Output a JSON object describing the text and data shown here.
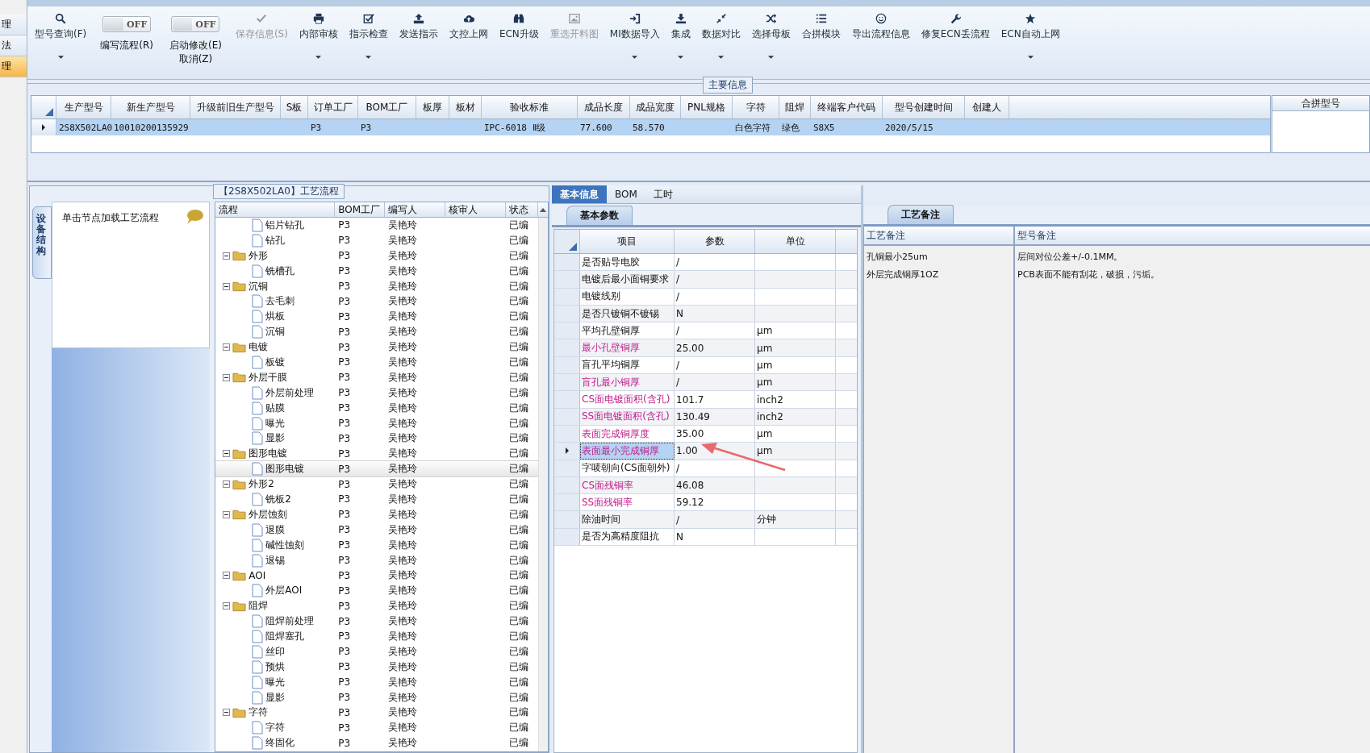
{
  "nav": {
    "items": [
      {
        "label": "理",
        "selected": false
      },
      {
        "label": "法",
        "selected": false
      },
      {
        "label": "理",
        "selected": true
      }
    ]
  },
  "toolbar": {
    "items": [
      {
        "kind": "button",
        "lines": [
          "型号查询(F)"
        ],
        "disabled": false,
        "dropdown": true
      },
      {
        "kind": "toggle",
        "state_text": "OFF",
        "on": false,
        "lines": [
          "编写流程(R)"
        ]
      },
      {
        "kind": "toggle",
        "state_text": "OFF",
        "on": false,
        "lines": [
          "启动修改(E)",
          "取消(Z)"
        ]
      },
      {
        "kind": "button",
        "lines": [
          "保存信息(S)"
        ],
        "disabled": true,
        "dropdown": false
      },
      {
        "kind": "button",
        "lines": [
          "内部审核"
        ],
        "disabled": false,
        "dropdown": true
      },
      {
        "kind": "button",
        "lines": [
          "指示检查"
        ],
        "disabled": false,
        "dropdown": true
      },
      {
        "kind": "button",
        "lines": [
          "发送指示"
        ],
        "disabled": false,
        "dropdown": false
      },
      {
        "kind": "button",
        "lines": [
          "文控上网"
        ],
        "disabled": false,
        "dropdown": false
      },
      {
        "kind": "button",
        "lines": [
          "ECN升级"
        ],
        "disabled": false,
        "dropdown": false
      },
      {
        "kind": "button",
        "lines": [
          "重选开料图"
        ],
        "disabled": true,
        "dropdown": false
      },
      {
        "kind": "button",
        "lines": [
          "MI数据导入"
        ],
        "disabled": false,
        "dropdown": true
      },
      {
        "kind": "button",
        "lines": [
          "集成"
        ],
        "disabled": false,
        "dropdown": true
      },
      {
        "kind": "button",
        "lines": [
          "数据对比"
        ],
        "disabled": false,
        "dropdown": true
      },
      {
        "kind": "button",
        "lines": [
          "选择母板"
        ],
        "disabled": false,
        "dropdown": true
      },
      {
        "kind": "button",
        "lines": [
          "合拼模块"
        ],
        "disabled": false,
        "dropdown": false
      },
      {
        "kind": "button",
        "lines": [
          "导出流程信息"
        ],
        "disabled": false,
        "dropdown": false
      },
      {
        "kind": "button",
        "lines": [
          "修复ECN丢流程"
        ],
        "disabled": false,
        "dropdown": false
      },
      {
        "kind": "button",
        "lines": [
          "ECN自动上网"
        ],
        "disabled": false,
        "dropdown": true
      }
    ]
  },
  "main_info": {
    "title": "主要信息",
    "columns": [
      "生产型号",
      "新生产型号",
      "升级前旧生产型号",
      "S板",
      "订单工厂",
      "BOM工厂",
      "板厚",
      "板材",
      "验收标准",
      "成品长度",
      "成品宽度",
      "PNL规格",
      "字符",
      "阻焊",
      "终端客户代码",
      "型号创建时间",
      "创建人"
    ],
    "rows": [
      {
        "selected": true,
        "cells": [
          "2S8X502LA0",
          "10010200135929",
          null,
          null,
          "P3",
          "P3",
          null,
          null,
          "IPC-6018 Ⅱ级",
          "77.600",
          "58.570",
          null,
          "白色字符",
          "绿色",
          "S8X5",
          "2020/5/15",
          null
        ]
      }
    ],
    "side_column": "合拼型号"
  },
  "process": {
    "title": "【2S8X502LA0】工艺流程",
    "side_tab": "设备结构",
    "hint": "单击节点加载工艺流程",
    "columns": [
      "流程",
      "BOM工厂",
      "编写人",
      "核审人",
      "状态"
    ],
    "tree": [
      {
        "name": "铝片钻孔",
        "bom": "P3",
        "writer": "吴艳玲",
        "status": "已编",
        "selected": false
      },
      {
        "name": "钻孔",
        "bom": "P3",
        "writer": "吴艳玲",
        "status": "已编",
        "selected": false
      },
      {
        "name": "外形",
        "bom": "P3",
        "writer": "吴艳玲",
        "status": "已编",
        "selected": false,
        "expanded": true,
        "children": [
          {
            "name": "铣槽孔",
            "bom": "P3",
            "writer": "吴艳玲",
            "status": "已编",
            "selected": false
          }
        ]
      },
      {
        "name": "沉铜",
        "bom": "P3",
        "writer": "吴艳玲",
        "status": "已编",
        "selected": false,
        "expanded": true,
        "children": [
          {
            "name": "去毛刺",
            "bom": "P3",
            "writer": "吴艳玲",
            "status": "已编",
            "selected": false
          },
          {
            "name": "烘板",
            "bom": "P3",
            "writer": "吴艳玲",
            "status": "已编",
            "selected": false
          },
          {
            "name": "沉铜",
            "bom": "P3",
            "writer": "吴艳玲",
            "status": "已编",
            "selected": false
          }
        ]
      },
      {
        "name": "电镀",
        "bom": "P3",
        "writer": "吴艳玲",
        "status": "已编",
        "selected": false,
        "expanded": true,
        "children": [
          {
            "name": "板镀",
            "bom": "P3",
            "writer": "吴艳玲",
            "status": "已编",
            "selected": false
          }
        ]
      },
      {
        "name": "外层干膜",
        "bom": "P3",
        "writer": "吴艳玲",
        "status": "已编",
        "selected": false,
        "expanded": true,
        "children": [
          {
            "name": "外层前处理",
            "bom": "P3",
            "writer": "吴艳玲",
            "status": "已编",
            "selected": false
          },
          {
            "name": "贴膜",
            "bom": "P3",
            "writer": "吴艳玲",
            "status": "已编",
            "selected": false
          },
          {
            "name": "曝光",
            "bom": "P3",
            "writer": "吴艳玲",
            "status": "已编",
            "selected": false
          },
          {
            "name": "显影",
            "bom": "P3",
            "writer": "吴艳玲",
            "status": "已编",
            "selected": false
          }
        ]
      },
      {
        "name": "图形电镀",
        "bom": "P3",
        "writer": "吴艳玲",
        "status": "已编",
        "selected": false,
        "expanded": true,
        "children": [
          {
            "name": "图形电镀",
            "bom": "P3",
            "writer": "吴艳玲",
            "status": "已编",
            "selected": true
          }
        ]
      },
      {
        "name": "外形2",
        "bom": "P3",
        "writer": "吴艳玲",
        "status": "已编",
        "selected": false,
        "expanded": true,
        "children": [
          {
            "name": "铣板2",
            "bom": "P3",
            "writer": "吴艳玲",
            "status": "已编",
            "selected": false
          }
        ]
      },
      {
        "name": "外层蚀刻",
        "bom": "P3",
        "writer": "吴艳玲",
        "status": "已编",
        "selected": false,
        "expanded": true,
        "children": [
          {
            "name": "退膜",
            "bom": "P3",
            "writer": "吴艳玲",
            "status": "已编",
            "selected": false
          },
          {
            "name": "碱性蚀刻",
            "bom": "P3",
            "writer": "吴艳玲",
            "status": "已编",
            "selected": false
          },
          {
            "name": "退锡",
            "bom": "P3",
            "writer": "吴艳玲",
            "status": "已编",
            "selected": false
          }
        ]
      },
      {
        "name": "AOI",
        "bom": "P3",
        "writer": "吴艳玲",
        "status": "已编",
        "selected": false,
        "expanded": true,
        "children": [
          {
            "name": "外层AOI",
            "bom": "P3",
            "writer": "吴艳玲",
            "status": "已编",
            "selected": false
          }
        ]
      },
      {
        "name": "阻焊",
        "bom": "P3",
        "writer": "吴艳玲",
        "status": "已编",
        "selected": false,
        "expanded": true,
        "children": [
          {
            "name": "阻焊前处理",
            "bom": "P3",
            "writer": "吴艳玲",
            "status": "已编",
            "selected": false
          },
          {
            "name": "阻焊塞孔",
            "bom": "P3",
            "writer": "吴艳玲",
            "status": "已编",
            "selected": false
          },
          {
            "name": "丝印",
            "bom": "P3",
            "writer": "吴艳玲",
            "status": "已编",
            "selected": false
          },
          {
            "name": "预烘",
            "bom": "P3",
            "writer": "吴艳玲",
            "status": "已编",
            "selected": false
          },
          {
            "name": "曝光",
            "bom": "P3",
            "writer": "吴艳玲",
            "status": "已编",
            "selected": false
          },
          {
            "name": "显影",
            "bom": "P3",
            "writer": "吴艳玲",
            "status": "已编",
            "selected": false
          }
        ]
      },
      {
        "name": "字符",
        "bom": "P3",
        "writer": "吴艳玲",
        "status": "已编",
        "selected": false,
        "expanded": true,
        "children": [
          {
            "name": "字符",
            "bom": "P3",
            "writer": "吴艳玲",
            "status": "已编",
            "selected": false
          },
          {
            "name": "终固化",
            "bom": "P3",
            "writer": "吴艳玲",
            "status": "已编",
            "selected": false
          }
        ]
      }
    ]
  },
  "detail": {
    "tabs": [
      {
        "label": "基本信息",
        "selected": true
      },
      {
        "label": "BOM",
        "selected": false
      },
      {
        "label": "工时",
        "selected": false
      }
    ],
    "subtab": "基本参数",
    "columns": [
      "项目",
      "参数",
      "单位"
    ],
    "rows": [
      {
        "item": "是否贴导电胶",
        "value": "/",
        "flagged": false,
        "selected": false
      },
      {
        "item": "电镀后最小面铜要求",
        "value": "/",
        "flagged": false,
        "selected": false
      },
      {
        "item": "电镀线别",
        "value": "/",
        "flagged": false,
        "selected": false
      },
      {
        "item": "是否只镀铜不镀锡",
        "value": "N",
        "flagged": false,
        "selected": false
      },
      {
        "item": "平均孔壁铜厚",
        "value": "/",
        "unit": "μm",
        "flagged": false,
        "selected": false
      },
      {
        "item": "最小孔壁铜厚",
        "value": "25.00",
        "unit": "μm",
        "flagged": true,
        "selected": false
      },
      {
        "item": "盲孔平均铜厚",
        "value": "/",
        "unit": "μm",
        "flagged": false,
        "selected": false
      },
      {
        "item": "盲孔最小铜厚",
        "value": "/",
        "unit": "μm",
        "flagged": true,
        "selected": false
      },
      {
        "item": "CS面电镀面积(含孔)",
        "value": "101.7",
        "unit": "inch2",
        "flagged": true,
        "selected": false
      },
      {
        "item": "SS面电镀面积(含孔)",
        "value": "130.49",
        "unit": "inch2",
        "flagged": true,
        "selected": false
      },
      {
        "item": "表面完成铜厚度",
        "value": "35.00",
        "unit": "μm",
        "flagged": true,
        "selected": false
      },
      {
        "item": "表面最小完成铜厚",
        "value": "1.00",
        "unit": "μm",
        "flagged": true,
        "selected": true
      },
      {
        "item": "字唛朝向(CS面朝外)",
        "value": "/",
        "flagged": false,
        "selected": false
      },
      {
        "item": "CS面残铜率",
        "value": "46.08",
        "flagged": true,
        "selected": false
      },
      {
        "item": "SS面残铜率",
        "value": "59.12",
        "flagged": true,
        "selected": false
      },
      {
        "item": "除油时间",
        "value": "/",
        "unit": "分钟",
        "flagged": false,
        "selected": false
      },
      {
        "item": "是否为高精度阻抗",
        "value": "N",
        "flagged": false,
        "selected": false
      }
    ]
  },
  "remarks": {
    "tab": "工艺备注",
    "columns": [
      "工艺备注",
      "型号备注"
    ],
    "process_notes": [
      "孔铜最小25um",
      "外层完成铜厚1OZ"
    ],
    "model_notes": [
      "层间对位公差+/-0.1MM。",
      "PCB表面不能有刮花，破损，污垢。"
    ]
  }
}
